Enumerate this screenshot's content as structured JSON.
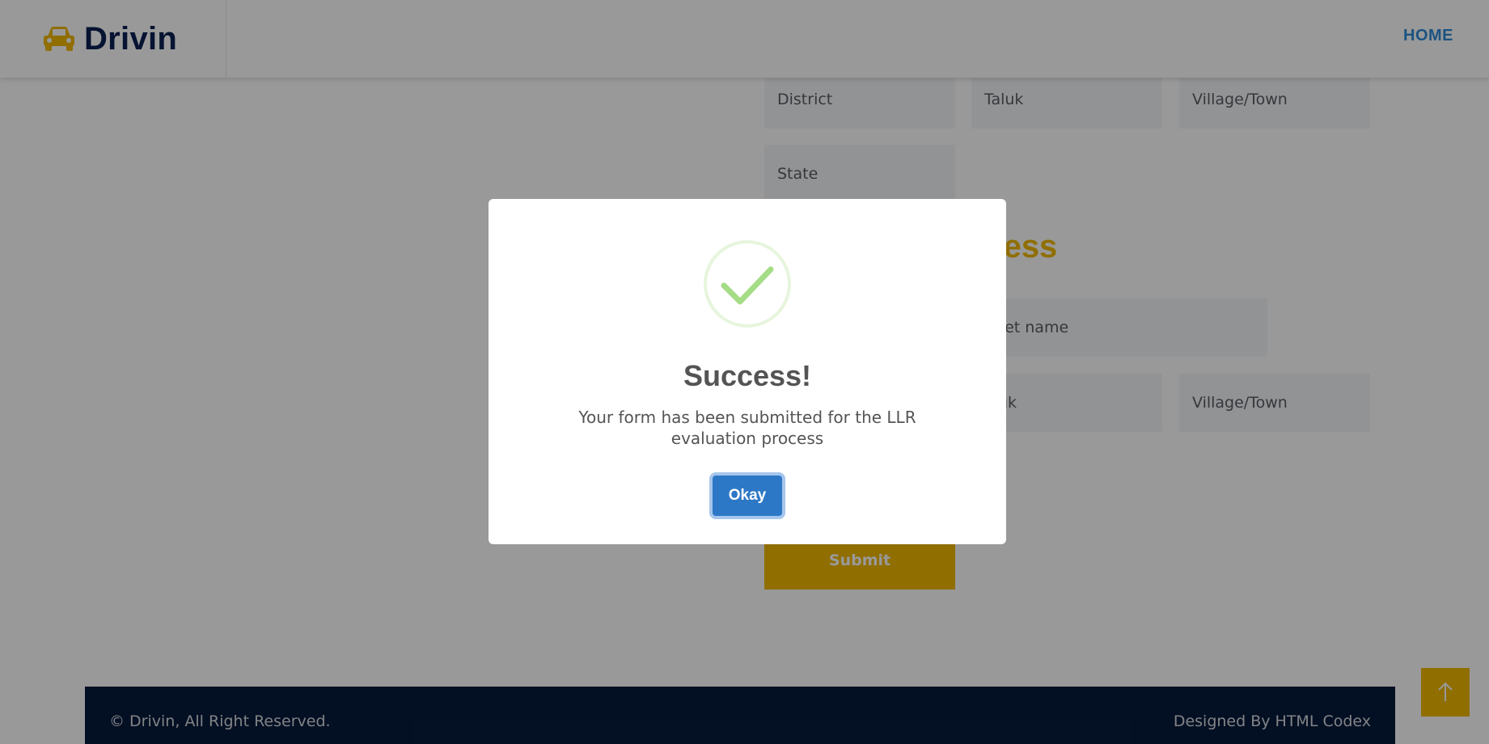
{
  "navbar": {
    "brand": "Drivin",
    "brand_icon": "car-icon",
    "home_link": "HOME"
  },
  "form": {
    "district_placeholder": "District",
    "taluk_placeholder": "Taluk",
    "village_placeholder": "Village/Town",
    "state_placeholder": "State",
    "section_title_fragment": "ress",
    "street_placeholder_fragment": "reet name",
    "taluk_fragment": "uk",
    "village2_placeholder": "Village/Town",
    "submit_label": "Submit"
  },
  "footer": {
    "copyright": "© Drivin, All Right Reserved.",
    "credit": "Designed By HTML Codex"
  },
  "back_to_top_icon": "arrow-up-icon",
  "modal": {
    "icon": "check-circle-icon",
    "title": "Success!",
    "message": "Your form has been submitted for the LLR evaluation process",
    "button_label": "Okay"
  },
  "colors": {
    "accent": "#f0b800",
    "brand_dark": "#0b2154",
    "link": "#2f8ad8",
    "footer_bg": "#061a3a",
    "button_blue": "#2d78c6",
    "success_green": "#a5dc86"
  }
}
